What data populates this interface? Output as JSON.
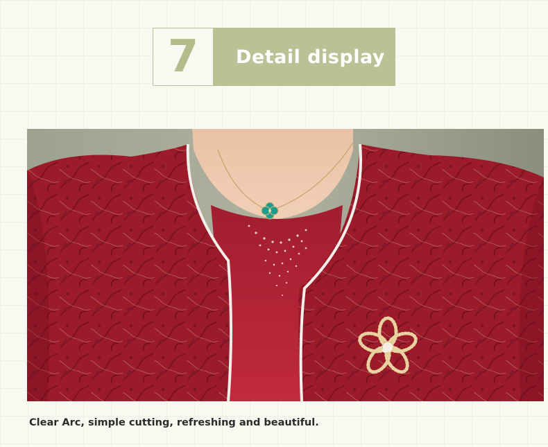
{
  "section": {
    "number": "7",
    "title": "Detail display"
  },
  "photo": {
    "subject": "red-jacquard-jacket-closeup",
    "colors": {
      "accent": "#b8c294",
      "fabric": "#9b1b2a",
      "piping": "#f3eee9",
      "pendant": "#1e9e8a"
    }
  },
  "caption": "Clear Arc, simple cutting, refreshing and beautiful."
}
